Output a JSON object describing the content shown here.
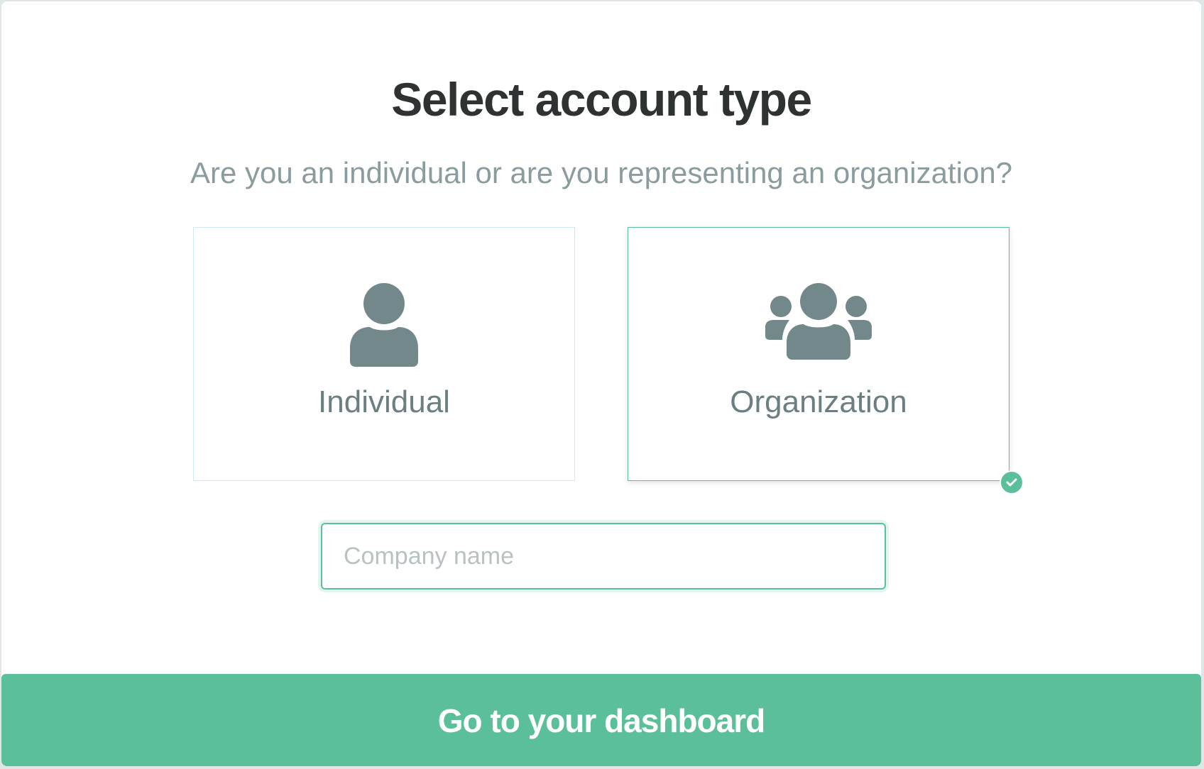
{
  "title": "Select account type",
  "subtitle": "Are you an individual or are you representing an organization?",
  "options": [
    {
      "label": "Individual",
      "icon": "user-icon",
      "selected": false
    },
    {
      "label": "Organization",
      "icon": "users-icon",
      "selected": true
    }
  ],
  "company_input": {
    "value": "",
    "placeholder": "Company name"
  },
  "cta": {
    "label": "Go to your dashboard"
  },
  "colors": {
    "accent": "#5bbf9a",
    "icon": "#72888a",
    "title": "#2f3233",
    "subtitle": "#8a9c9e"
  }
}
